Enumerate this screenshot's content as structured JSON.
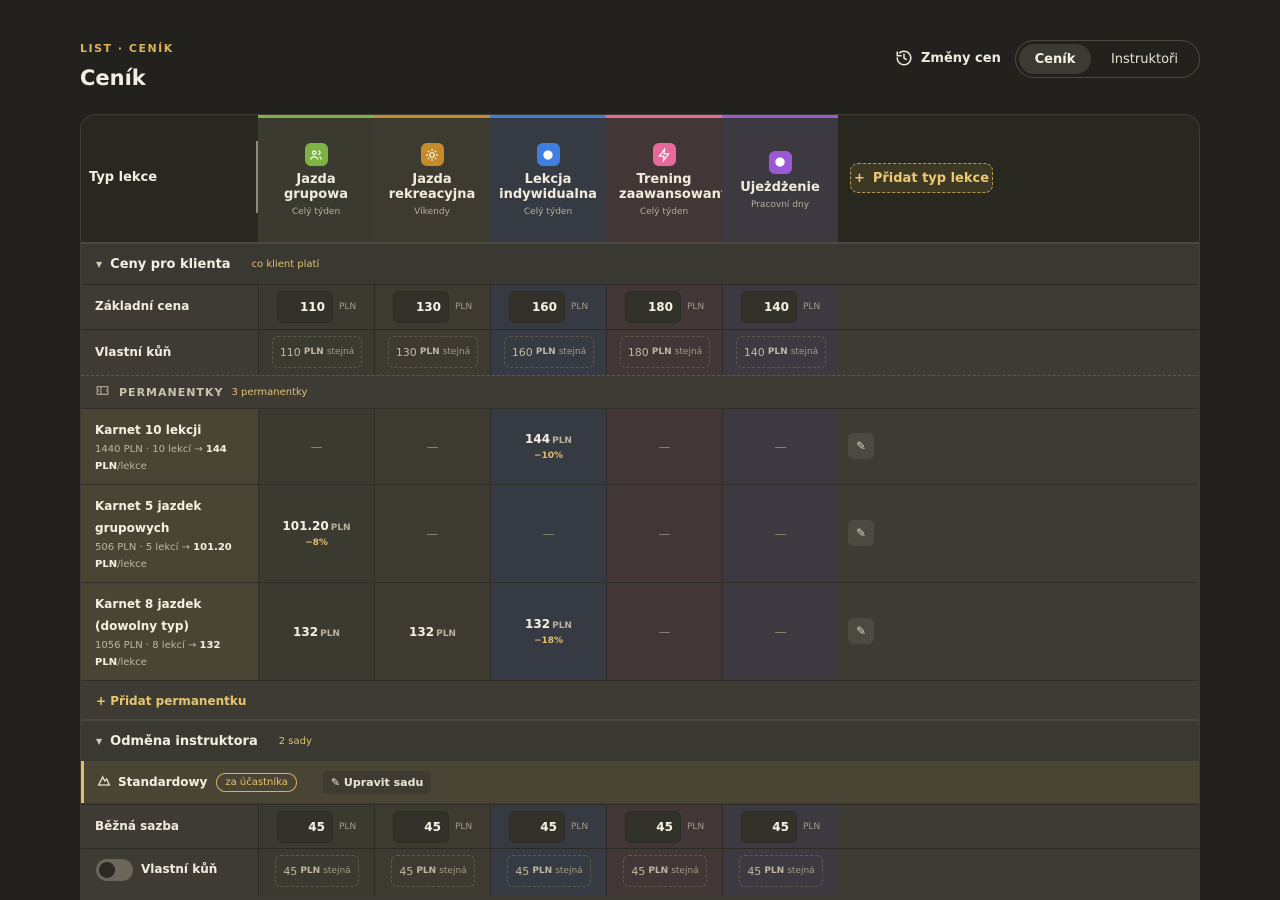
{
  "header": {
    "eyebrow": "LIST · CENÍK",
    "title": "Ceník",
    "changes_label": "Změny cen",
    "tabs": [
      {
        "label": "Ceník",
        "active": true
      },
      {
        "label": "Instruktoři",
        "active": false
      }
    ]
  },
  "table": {
    "row_label": "Typ lekce",
    "add_type_label": "Přidat typ lekce",
    "columns": [
      {
        "name": "Jazda grupowa",
        "sub": "Celý týden",
        "color": "#7cb342",
        "icon": "group-icon"
      },
      {
        "name": "Jazda rekreacyjna",
        "sub": "Víkendy",
        "color": "#c48a2c",
        "icon": "sun-icon"
      },
      {
        "name": "Lekcja indywidualna",
        "sub": "Celý týden",
        "color": "#3f7fe0",
        "icon": "dot-icon"
      },
      {
        "name": "Trening zaawansowany",
        "sub": "Celý týden",
        "color": "#e56a9b",
        "icon": "bolt-icon"
      },
      {
        "name": "Ujeżdżenie",
        "sub": "Pracovní dny",
        "color": "#9b59d6",
        "icon": "dot-icon"
      }
    ]
  },
  "client_prices": {
    "title": "Ceny pro klienta",
    "note": "co klient platí",
    "base": {
      "label": "Základní cena",
      "values": [
        "110",
        "130",
        "160",
        "180",
        "140"
      ],
      "currency": "PLN"
    },
    "own_horse": {
      "label": "Vlastní kůň",
      "values": [
        "110",
        "130",
        "160",
        "180",
        "140"
      ],
      "currency": "PLN",
      "same": "stejná"
    }
  },
  "passes": {
    "title": "PERMANENTKY",
    "count": "3 permanentky",
    "add_label": "Přidat permanentku",
    "items": [
      {
        "name_lines": [
          "Karnet 10 lekcji"
        ],
        "detail_a": "1440 PLN · 10 lekcí → ",
        "detail_b": "144",
        "detail_c": "PLN",
        "detail_d": "/lekce",
        "cells": [
          {
            "v": "—"
          },
          {
            "v": "—"
          },
          {
            "v": "144",
            "cur": "PLN",
            "pct": "−10%"
          },
          {
            "v": "—"
          },
          {
            "v": "—"
          }
        ]
      },
      {
        "name_lines": [
          "Karnet 5 jazdek",
          "grupowych"
        ],
        "detail_a": "506 PLN · 5 lekcí → ",
        "detail_b": "101.20",
        "detail_c": "PLN",
        "detail_d": "/lekce",
        "cells": [
          {
            "v": "101.20",
            "cur": "PLN",
            "pct": "−8%"
          },
          {
            "v": "—"
          },
          {
            "v": "—"
          },
          {
            "v": "—"
          },
          {
            "v": "—"
          }
        ]
      },
      {
        "name_lines": [
          "Karnet 8 jazdek",
          "(dowolny typ)"
        ],
        "detail_a": "1056 PLN · 8 lekcí → ",
        "detail_b": "132",
        "detail_c": "PLN",
        "detail_d": "/lekce",
        "cells": [
          {
            "v": "132",
            "cur": "PLN"
          },
          {
            "v": "132",
            "cur": "PLN"
          },
          {
            "v": "132",
            "cur": "PLN",
            "pct": "−18%"
          },
          {
            "v": "—"
          },
          {
            "v": "—"
          }
        ]
      }
    ]
  },
  "instructor": {
    "title": "Odměna instruktora",
    "note": "2 sady",
    "set": {
      "name": "Standardowy",
      "tag": "za účastníka",
      "edit": "✎ Upravit sadu"
    },
    "rate": {
      "label": "Běžná sazba",
      "values": [
        "45",
        "45",
        "45",
        "45",
        "45"
      ],
      "currency": "PLN"
    },
    "own_horse": {
      "label": "Vlastní kůň",
      "toggle_on": false,
      "values": [
        "45",
        "45",
        "45",
        "45",
        "45"
      ],
      "currency": "PLN",
      "same": "stejná"
    }
  }
}
